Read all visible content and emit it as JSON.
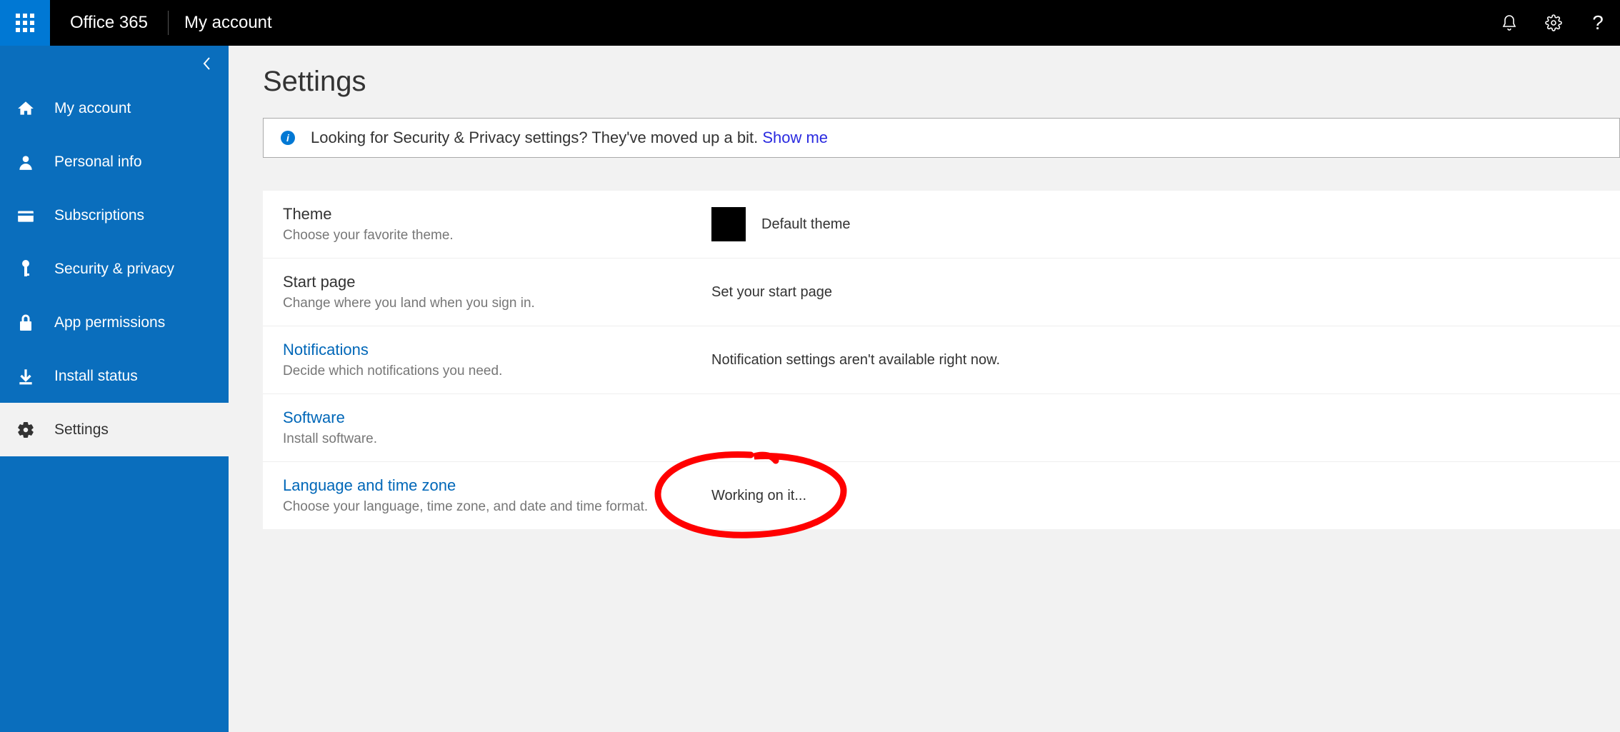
{
  "header": {
    "brand": "Office 365",
    "app_title": "My account"
  },
  "sidebar": {
    "items": [
      {
        "label": "My account"
      },
      {
        "label": "Personal info"
      },
      {
        "label": "Subscriptions"
      },
      {
        "label": "Security & privacy"
      },
      {
        "label": "App permissions"
      },
      {
        "label": "Install status"
      },
      {
        "label": "Settings"
      }
    ]
  },
  "main": {
    "title": "Settings",
    "banner_text": "Looking for Security & Privacy settings? They've moved up a bit. ",
    "banner_link": "Show me",
    "rows": [
      {
        "title": "Theme",
        "desc": "Choose your favorite theme.",
        "value": "Default theme"
      },
      {
        "title": "Start page",
        "desc": "Change where you land when you sign in.",
        "value": "Set your start page"
      },
      {
        "title": "Notifications",
        "desc": "Decide which notifications you need.",
        "value": "Notification settings aren't available right now."
      },
      {
        "title": "Software",
        "desc": "Install software.",
        "value": ""
      },
      {
        "title": "Language and time zone",
        "desc": "Choose your language, time zone, and date and time format.",
        "value": "Working on it..."
      }
    ]
  }
}
